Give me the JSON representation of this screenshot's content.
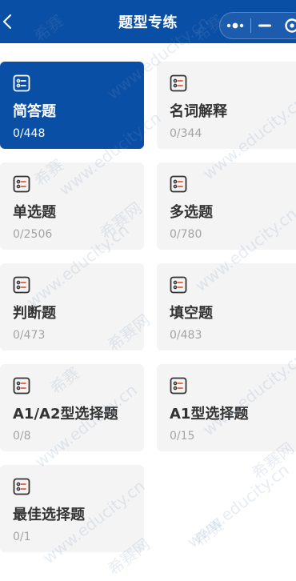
{
  "nav": {
    "title": "题型专练"
  },
  "colors": {
    "brand": "#0a4fa6",
    "card": "#f4f4f4",
    "count": "#a3a3a3"
  },
  "categories": [
    {
      "name": "简答题",
      "count": "0/448",
      "active": true
    },
    {
      "name": "名词解释",
      "count": "0/344"
    },
    {
      "name": "单选题",
      "count": "0/2506"
    },
    {
      "name": "多选题",
      "count": "0/780"
    },
    {
      "name": "判断题",
      "count": "0/473"
    },
    {
      "name": "填空题",
      "count": "0/483"
    },
    {
      "name": "A1/A2型选择题",
      "count": "0/8"
    },
    {
      "name": "A1型选择题",
      "count": "0/15"
    },
    {
      "name": "最佳选择题",
      "count": "0/1"
    }
  ],
  "watermark": {
    "brand": "希赛",
    "site": "www.educity.cn",
    "site_cn": "希赛网"
  },
  "icons": {
    "back": "chevron-left-icon",
    "more": "more-dots-icon",
    "minimize": "minimize-icon",
    "close": "close-circle-icon",
    "card": "list-checklist-icon"
  }
}
